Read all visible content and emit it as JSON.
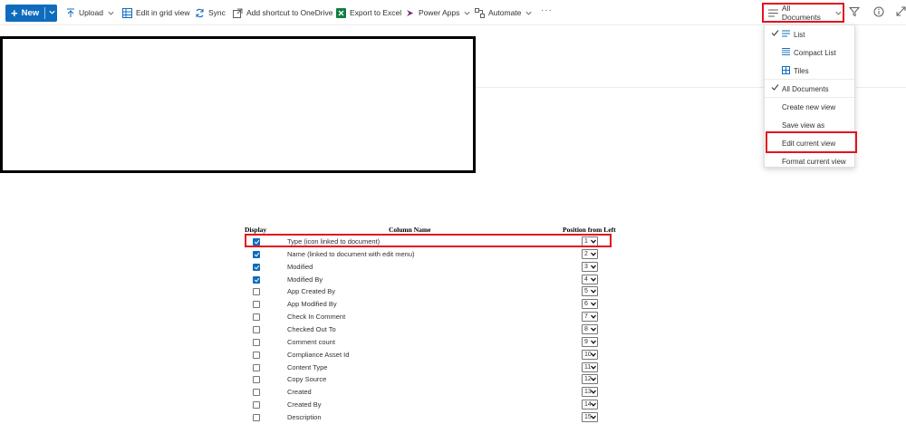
{
  "toolbar": {
    "new_label": "New",
    "items": [
      {
        "label": "Upload",
        "icon": "upload-icon"
      },
      {
        "label": "Edit in grid view",
        "icon": "grid-icon"
      },
      {
        "label": "Sync",
        "icon": "sync-icon"
      },
      {
        "label": "Add shortcut to OneDrive",
        "icon": "shortcut-icon"
      },
      {
        "label": "Export to Excel",
        "icon": "excel-icon"
      },
      {
        "label": "Power Apps",
        "icon": "powerapps-icon"
      },
      {
        "label": "Automate",
        "icon": "automate-icon"
      }
    ],
    "more_label": "···",
    "view_label": "All Documents",
    "filter_icon": "filter-icon",
    "info_icon": "info-icon",
    "expand_icon": "expand-icon"
  },
  "view_menu": {
    "items": [
      {
        "label": "List",
        "checked": true,
        "icon": "list-icon"
      },
      {
        "label": "Compact List",
        "checked": false,
        "icon": "compact-list-icon"
      },
      {
        "label": "Tiles",
        "checked": false,
        "icon": "tiles-icon"
      },
      {
        "label": "All Documents",
        "checked": true
      },
      {
        "label": "Create new view"
      },
      {
        "label": "Save view as"
      },
      {
        "label": "Edit current view",
        "highlighted": true
      },
      {
        "label": "Format current view"
      }
    ]
  },
  "columns_table": {
    "headers": {
      "display": "Display",
      "column_name": "Column Name",
      "position": "Position from Left"
    },
    "rows": [
      {
        "checked": true,
        "name": "Type (icon linked to document)",
        "position": "1"
      },
      {
        "checked": true,
        "name": "Name (linked to document with edit menu)",
        "position": "2"
      },
      {
        "checked": true,
        "name": "Modified",
        "position": "3"
      },
      {
        "checked": true,
        "name": "Modified By",
        "position": "4"
      },
      {
        "checked": false,
        "name": "App Created By",
        "position": "5"
      },
      {
        "checked": false,
        "name": "App Modified By",
        "position": "6"
      },
      {
        "checked": false,
        "name": "Check In Comment",
        "position": "7"
      },
      {
        "checked": false,
        "name": "Checked Out To",
        "position": "8"
      },
      {
        "checked": false,
        "name": "Comment count",
        "position": "9"
      },
      {
        "checked": false,
        "name": "Compliance Asset Id",
        "position": "10"
      },
      {
        "checked": false,
        "name": "Content Type",
        "position": "11"
      },
      {
        "checked": false,
        "name": "Copy Source",
        "position": "12"
      },
      {
        "checked": false,
        "name": "Created",
        "position": "13"
      },
      {
        "checked": false,
        "name": "Created By",
        "position": "14"
      },
      {
        "checked": false,
        "name": "Description",
        "position": "15"
      }
    ]
  },
  "colors": {
    "accent": "#0f6cbd",
    "highlight": "#e3131e"
  }
}
